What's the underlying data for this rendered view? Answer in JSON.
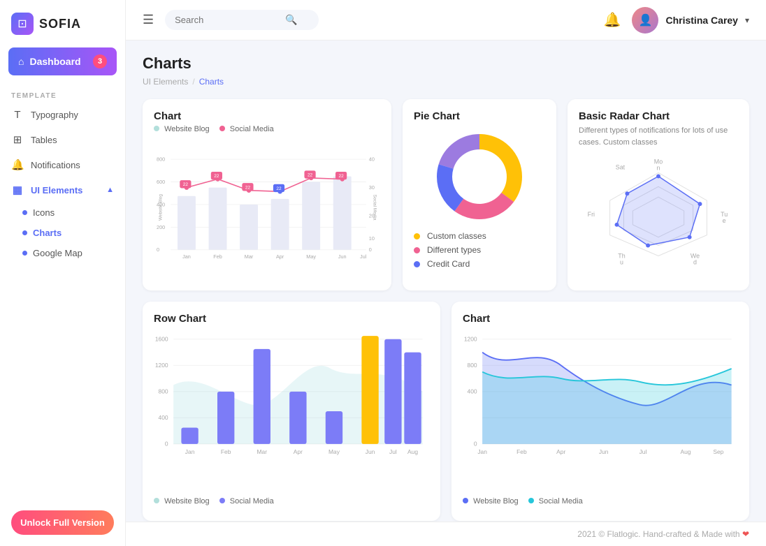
{
  "app": {
    "name": "SOFIA"
  },
  "sidebar": {
    "dashboard_label": "Dashboard",
    "dashboard_badge": "3",
    "section_label": "TEMPLATE",
    "items": [
      {
        "id": "typography",
        "label": "Typography",
        "icon": "T"
      },
      {
        "id": "tables",
        "label": "Tables",
        "icon": "⊞"
      },
      {
        "id": "notifications",
        "label": "Notifications",
        "icon": "🔔"
      },
      {
        "id": "ui-elements",
        "label": "UI Elements",
        "icon": "▦",
        "active": true,
        "expanded": true
      }
    ],
    "sub_items": [
      {
        "id": "icons",
        "label": "Icons"
      },
      {
        "id": "charts",
        "label": "Charts",
        "active": true
      },
      {
        "id": "google-map",
        "label": "Google Map"
      }
    ],
    "unlock_label": "Unlock Full Version"
  },
  "header": {
    "search_placeholder": "Search",
    "user_name": "Christina Carey"
  },
  "breadcrumb": {
    "parent": "UI Elements",
    "current": "Charts"
  },
  "page": {
    "title": "Charts"
  },
  "chart_card": {
    "title": "Chart",
    "legend": [
      {
        "label": "Website Blog",
        "color": "#b2dfdb"
      },
      {
        "label": "Social Media",
        "color": "#f06292"
      }
    ]
  },
  "pie_card": {
    "title": "Pie Chart",
    "legend": [
      {
        "label": "Custom classes",
        "color": "#ffc107"
      },
      {
        "label": "Different types",
        "color": "#f06292"
      },
      {
        "label": "Credit Card",
        "color": "#5b6ef5"
      }
    ]
  },
  "radar_card": {
    "title": "Basic Radar Chart",
    "description": "Different types of notifications for lots of use cases. Custom classes"
  },
  "row_chart_card": {
    "title": "Row Chart",
    "legend": [
      {
        "label": "Website Blog",
        "color": "#b2dfdb"
      },
      {
        "label": "Social Media",
        "color": "#7c7cf7"
      }
    ]
  },
  "bottom_chart_card": {
    "title": "Chart",
    "legend": [
      {
        "label": "Website Blog",
        "color": "#5b6ef5"
      },
      {
        "label": "Social Media",
        "color": "#26c6da"
      }
    ]
  },
  "footer": {
    "text": "2021 © Flatlogic. Hand-crafted & Made with"
  }
}
